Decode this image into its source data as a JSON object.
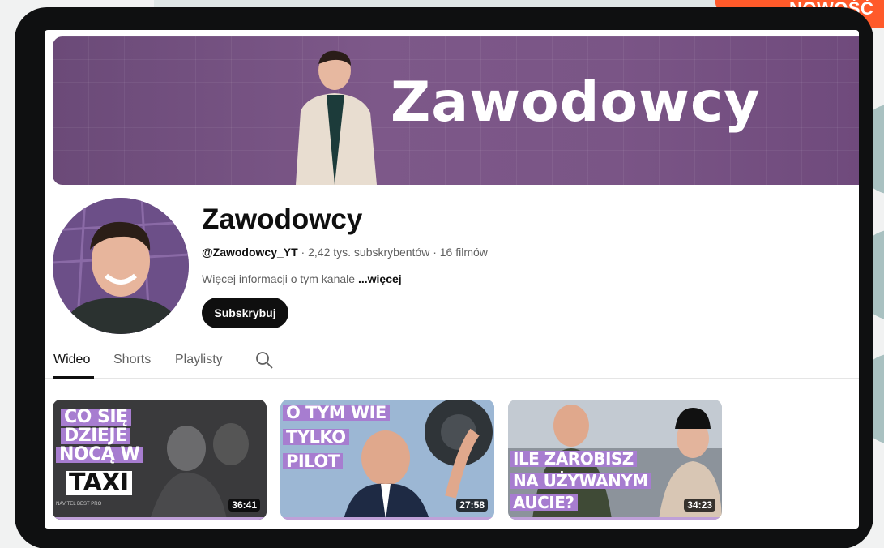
{
  "header_tag": "NOWOŚĆ",
  "banner": {
    "title": "Zawodowcy"
  },
  "channel": {
    "name": "Zawodowcy",
    "handle": "@Zawodowcy_YT",
    "stats": " · 2,42 tys. subskrybentów · 16 filmów",
    "description": "Więcej informacji o tym kanale ",
    "more_label": "...więcej",
    "subscribe_label": "Subskrybuj"
  },
  "tabs": [
    {
      "label": "Wideo",
      "active": true
    },
    {
      "label": "Shorts",
      "active": false
    },
    {
      "label": "Playlisty",
      "active": false
    }
  ],
  "videos": [
    {
      "duration": "36:41",
      "caption_lines": [
        "CO SIĘ",
        "DZIEJE",
        "NOCĄ W",
        "TAXI"
      ],
      "small_text": "NAVITEL BEST PRO"
    },
    {
      "duration": "27:58",
      "caption_lines": [
        "O TYM WIE",
        "TYLKO",
        "PILOT"
      ]
    },
    {
      "duration": "34:23",
      "caption_lines": [
        "ILE ZAROBISZ",
        "NA UŻYWANYM",
        "AUCIE?"
      ]
    }
  ],
  "colors": {
    "accent_orange": "#ff5a2a",
    "banner_purple": "#7d5889",
    "caption_purple": "#a77dd0"
  }
}
